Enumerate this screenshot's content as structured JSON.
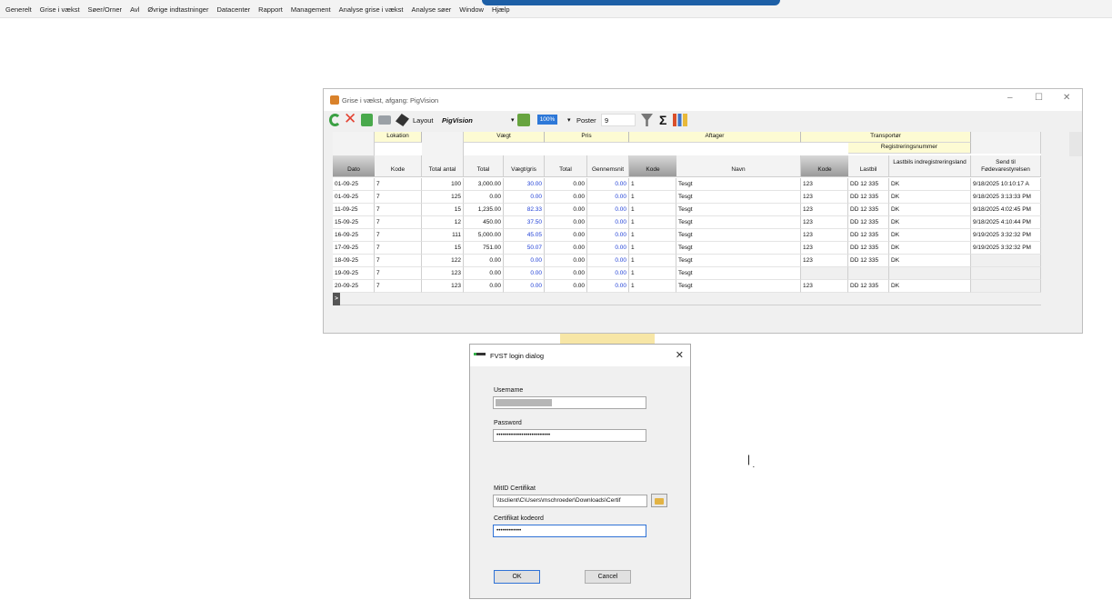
{
  "menu": [
    "Generelt",
    "Grise i vækst",
    "Søer/Orner",
    "Avl",
    "Øvrige indtastninger",
    "Datacenter",
    "Rapport",
    "Management",
    "Analyse grise i vækst",
    "Analyse søer",
    "Window",
    "Hjælp"
  ],
  "window": {
    "title": "Grise i vækst, afgang: PigVision",
    "controls": {
      "min": "–",
      "max": "☐",
      "close": "✕"
    }
  },
  "toolbar": {
    "layout_label": "Layout",
    "layout_value": "PigVision",
    "zoom": "100%",
    "poster_label": "Poster",
    "poster_value": "9",
    "sum_symbol": "Σ",
    "dropdown_arrow": "▾"
  },
  "grid": {
    "groups": {
      "lokation": "Lokation",
      "vaegt": "Vægt",
      "pris": "Pris",
      "aftager": "Aftager",
      "transportoer": "Transportør",
      "registreringsnummer": "Registreringsnummer"
    },
    "columns": {
      "dato": "Dato",
      "kode": "Kode",
      "total_antal": "Total antal",
      "vaegt_total": "Total",
      "vaegt_gris": "Vægt/gris",
      "pris_total": "Total",
      "gennemsnit": "Gennemsnit",
      "aftager_kode": "Kode",
      "navn": "Navn",
      "transport_kode": "Kode",
      "lastbil": "Lastbil",
      "lastbils_land": "Lastbils indregistreringsland",
      "send_til": "Send til Fødevarestyrelsen"
    },
    "rows": [
      [
        "01-09-25",
        "7",
        "100",
        "3,000.00",
        "30.00",
        "0.00",
        "0.00",
        "1",
        "Tesgt",
        "123",
        "DD 12 335",
        "DK",
        "9/18/2025 10:10:17 A"
      ],
      [
        "01-09-25",
        "7",
        "125",
        "0.00",
        "0.00",
        "0.00",
        "0.00",
        "1",
        "Tesgt",
        "123",
        "DD 12 335",
        "DK",
        "9/18/2025 3:13:33 PM"
      ],
      [
        "11-09-25",
        "7",
        "15",
        "1,235.00",
        "82.33",
        "0.00",
        "0.00",
        "1",
        "Tesgt",
        "123",
        "DD 12 335",
        "DK",
        "9/18/2025 4:02:45 PM"
      ],
      [
        "15-09-25",
        "7",
        "12",
        "450.00",
        "37.50",
        "0.00",
        "0.00",
        "1",
        "Tesgt",
        "123",
        "DD 12 335",
        "DK",
        "9/18/2025 4:10:44 PM"
      ],
      [
        "16-09-25",
        "7",
        "111",
        "5,000.00",
        "45.05",
        "0.00",
        "0.00",
        "1",
        "Tesgt",
        "123",
        "DD 12 335",
        "DK",
        "9/19/2025 3:32:32 PM"
      ],
      [
        "17-09-25",
        "7",
        "15",
        "751.00",
        "50.07",
        "0.00",
        "0.00",
        "1",
        "Tesgt",
        "123",
        "DD 12 335",
        "DK",
        "9/19/2025 3:32:32 PM"
      ],
      [
        "18-09-25",
        "7",
        "122",
        "0.00",
        "0.00",
        "0.00",
        "0.00",
        "1",
        "Tesgt",
        "123",
        "DD 12 335",
        "DK",
        ""
      ],
      [
        "19-09-25",
        "7",
        "123",
        "0.00",
        "0.00",
        "0.00",
        "0.00",
        "1",
        "Tesgt",
        "",
        "",
        "",
        ""
      ],
      [
        "20-09-25",
        "7",
        "123",
        "0.00",
        "0.00",
        "0.00",
        "0.00",
        "1",
        "Tesgt",
        "123",
        "DD 12 335",
        "DK",
        ""
      ]
    ],
    "new_row_marker": ">"
  },
  "dialog": {
    "title": "FVST login dialog",
    "close": "✕",
    "username_label": "Username",
    "username_value": "",
    "password_label": "Password",
    "password_value": "••••••••••••••••••••••••••",
    "cert_label": "MitID Certifikat",
    "cert_value": "\\\\tsclient\\C\\Users\\mschroeder\\Downloads\\Certif",
    "cert_code_label": "Certifikat kodeord",
    "cert_code_value": "••••••••••••",
    "ok": "OK",
    "cancel": "Cancel"
  }
}
